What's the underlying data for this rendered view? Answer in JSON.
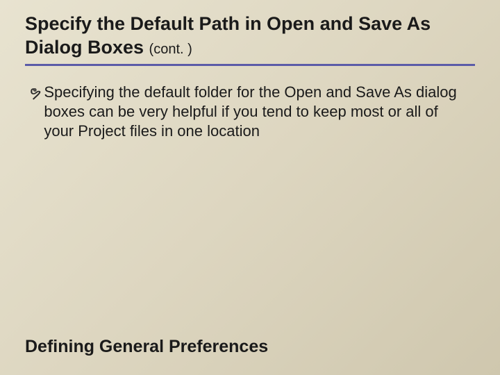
{
  "slide": {
    "title_main": "Specify the Default Path in Open and Save As Dialog Boxes ",
    "title_cont": "(cont. )",
    "bullets": [
      {
        "text": "Specifying the default folder for the Open and Save As dialog boxes can be very helpful if you tend to keep most or all of your Project files in one location"
      }
    ],
    "footer": "Defining General Preferences"
  }
}
